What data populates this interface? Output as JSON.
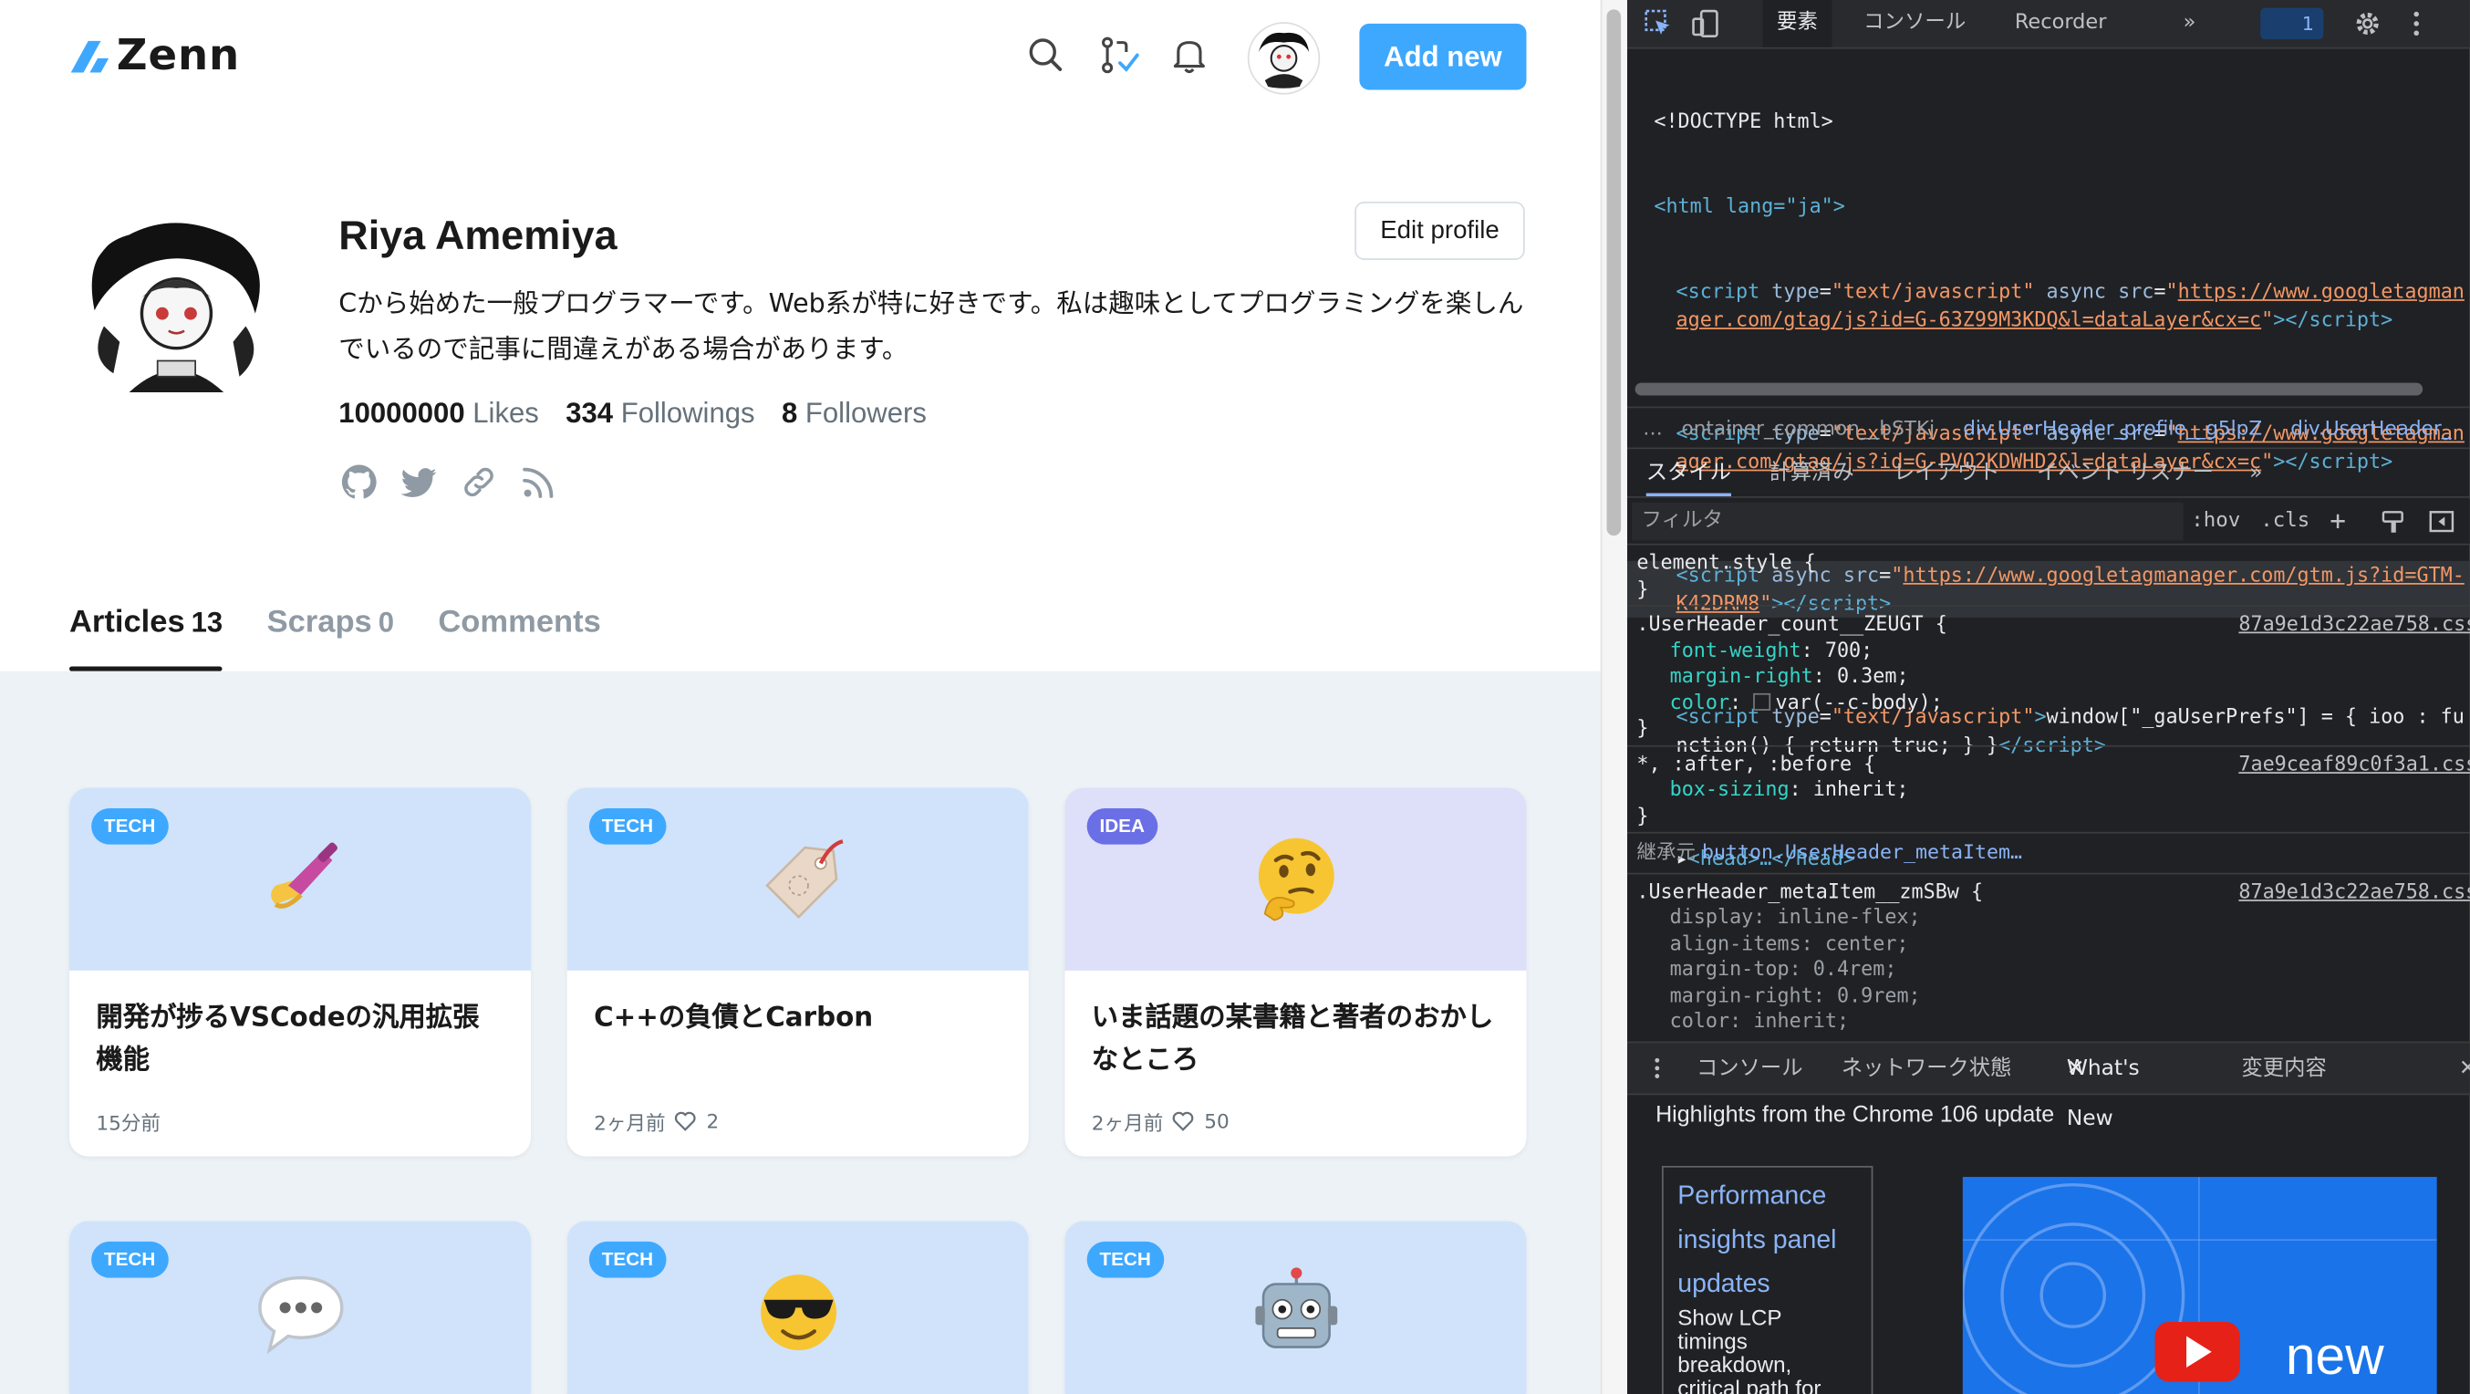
{
  "site": {
    "logo_text": "Zenn",
    "add_new_label": "Add new"
  },
  "profile": {
    "name": "Riya Amemiya",
    "edit_label": "Edit profile",
    "bio": "Cから始めた一般プログラマーです。Web系が特に好きです。私は趣味としてプログラミングを楽しんでいるので記事に間違えがある場合があります。",
    "likes_count": "10000000",
    "likes_label": "Likes",
    "followings_count": "334",
    "followings_label": "Followings",
    "followers_count": "8",
    "followers_label": "Followers",
    "social_icons": [
      "github-icon",
      "twitter-icon",
      "link-icon",
      "rss-icon"
    ]
  },
  "tabs": [
    {
      "label": "Articles",
      "count": "13",
      "active": true
    },
    {
      "label": "Scraps",
      "count": "0",
      "active": false
    },
    {
      "label": "Comments",
      "count": "",
      "active": false
    }
  ],
  "articles": [
    {
      "badge": "TECH",
      "emoji": "nail-polish",
      "title": "開発が捗るVSCodeの汎用拡張機能",
      "time": "15分前",
      "likes": ""
    },
    {
      "badge": "TECH",
      "emoji": "label-tag",
      "title": "C++の負債とCarbon",
      "time": "2ヶ月前",
      "likes": "2"
    },
    {
      "badge": "IDEA",
      "emoji": "thinking-face",
      "title": "いま話題の某書籍と著者のおかしなところ",
      "time": "2ヶ月前",
      "likes": "50"
    },
    {
      "badge": "TECH",
      "emoji": "speech-balloon"
    },
    {
      "badge": "TECH",
      "emoji": "sunglasses-face"
    },
    {
      "badge": "TECH",
      "emoji": "robot-face"
    }
  ],
  "devtools": {
    "tabs": {
      "elements": "要素",
      "console": "コンソール",
      "recorder": "Recorder",
      "more": "»",
      "issues_count": "1"
    },
    "code_lines": [
      {
        "kind": "doctype",
        "text": "<!DOCTYPE html>"
      },
      {
        "kind": "html",
        "text": "<html lang=\"ja\">"
      }
    ],
    "script1_src": "https://www.googletagmanager.com/gtag/js?id=G-63Z99M3KDQ&l=dataLayer&cx=c",
    "script2_src": "https://www.googletagmanager.com/gtag/js?id=G-PVQ2KDWHD2&l=dataLayer&cx=c",
    "script3_src": "https://www.googletagmanager.com/gtm.js?id=GTM-K42DRM8",
    "inline_script": "window[\"_gaUserPrefs\"] = { ioo : function() { return true; } }",
    "head_collapsed": "<head>…</head>",
    "breadcrumbs": [
      "…",
      "ontainer_common__bSTKj",
      "div.UserHeader_profile__g5lpZ",
      "div.UserHeader_"
    ],
    "subtabs": [
      "スタイル",
      "計算済み",
      "レイアウト",
      "イベント リスナー",
      "»"
    ],
    "filter_placeholder": "フィルタ",
    "filter_hov": ":hov",
    "filter_cls": ".cls",
    "rules": {
      "element_style": "element.style {",
      "count_selector": ".UserHeader_count__ZEUGT {",
      "count_src": "87a9e1d3c22ae758.css:1",
      "count_props": [
        {
          "name": "font-weight",
          "value": "700;"
        },
        {
          "name": "margin-right",
          "value": "0.3em;"
        },
        {
          "name": "color",
          "value": "var(--c-body);"
        }
      ],
      "star_selector": "*, :after, :before {",
      "star_src": "7ae9ceaf89c0f3a1.css:1",
      "star_props": [
        {
          "name": "box-sizing",
          "value": "inherit;"
        }
      ],
      "inherited_label": "継承元",
      "inherited_from": "button.UserHeader_metaItem…",
      "meta_selector": ".UserHeader_metaItem__zmSBw {",
      "meta_src": "87a9e1d3c22ae758.css:1",
      "meta_props": [
        {
          "name": "display",
          "value": "inline-flex;"
        },
        {
          "name": "align-items",
          "value": "center;"
        },
        {
          "name": "margin-top",
          "value": "0.4rem;"
        },
        {
          "name": "margin-right",
          "value": "0.9rem;"
        },
        {
          "name": "color",
          "value": "inherit;"
        }
      ],
      "close_brace": "}"
    },
    "drawer_tabs": {
      "console": "コンソール",
      "network": "ネットワーク状態",
      "whats_new": "What's New",
      "changes": "変更内容"
    },
    "whats_new_title": "Highlights from the Chrome 106 update",
    "wn_card_title": "Performance insights panel updates",
    "wn_card_desc": "Show LCP timings breakdown, critical path for",
    "wn_image_text": "new"
  },
  "colors": {
    "accent": "#3ea8ff",
    "tech_badge": "#3ea8ff",
    "idea_badge": "#6a6fe6",
    "devtools_bg": "#202124"
  }
}
